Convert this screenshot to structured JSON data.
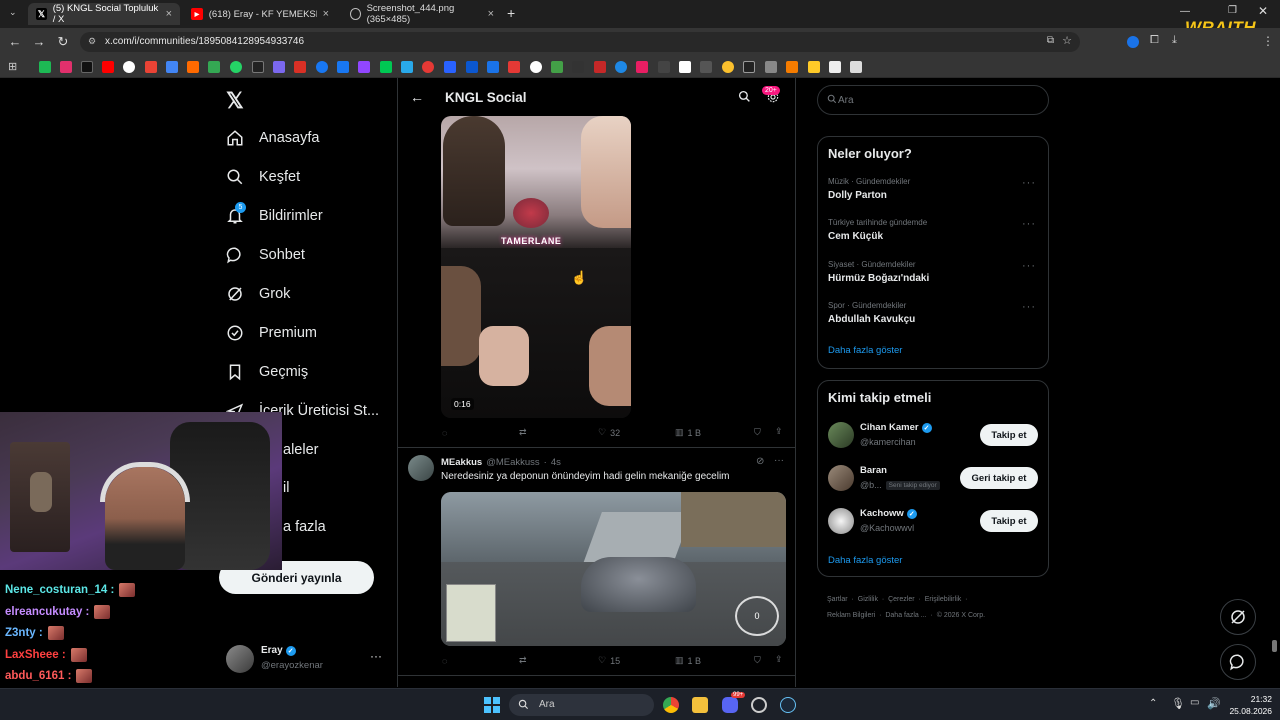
{
  "browser": {
    "tabs": [
      {
        "label": "(5) KNGL Social Topluluk / X",
        "active": true
      },
      {
        "label": "(618) Eray - KF YEMEKSEPETINI",
        "active": false
      },
      {
        "label": "Screenshot_444.png (365×485)",
        "active": false
      }
    ],
    "url": "x.com/i/communities/1895084128954933746",
    "overlay_logo": "WRAITH"
  },
  "sidebar": {
    "items": [
      {
        "label": "Anasayfa",
        "icon": "home-icon"
      },
      {
        "label": "Keşfet",
        "icon": "search-icon"
      },
      {
        "label": "Bildirimler",
        "icon": "bell-icon",
        "badge": "5"
      },
      {
        "label": "Sohbet",
        "icon": "chat-icon"
      },
      {
        "label": "Grok",
        "icon": "grok-icon"
      },
      {
        "label": "Premium",
        "icon": "premium-icon"
      },
      {
        "label": "Geçmiş",
        "icon": "bookmark-icon"
      },
      {
        "label": "İçerik Üreticisi St...",
        "icon": "creator-icon"
      },
      {
        "label": "Makaleler",
        "icon": "article-icon"
      },
      {
        "label": "Profil",
        "icon": "profile-icon"
      },
      {
        "label": "Daha fazla",
        "icon": "more-icon"
      }
    ],
    "visible_partial": {
      "articles": "aleler",
      "profile": "il",
      "more": "a fazla"
    },
    "post_button": "Gönderi yayınla",
    "account": {
      "name": "Eray",
      "handle": "@erayozkenar"
    }
  },
  "header": {
    "title": "KNGL Social",
    "notif_badge": "20+"
  },
  "posts": [
    {
      "media_text": "TAMERLANE",
      "video_duration": "0:16",
      "likes": "32",
      "views": "1 B"
    },
    {
      "author": "MEakkus",
      "handle": "@MEakkuss",
      "time": "4s",
      "text": "Neredesiniz ya deponun önündeyim hadi gelin mekaniğe gecelim",
      "speed": "0",
      "likes": "15",
      "views": "1 B"
    }
  ],
  "right": {
    "search_placeholder": "Ara",
    "trends_title": "Neler oluyor?",
    "trends": [
      {
        "category": "Müzik · Gündemdekiler",
        "name": "Dolly Parton"
      },
      {
        "category": "Türkiye tarihinde gündemde",
        "name": "Cem Küçük"
      },
      {
        "category": "Siyaset · Gündemdekiler",
        "name": "Hürmüz Boğazı'ndaki"
      },
      {
        "category": "Spor · Gündemdekiler",
        "name": "Abdullah Kavukçu"
      }
    ],
    "show_more": "Daha fazla göster",
    "who_title": "Kimi takip etmeli",
    "who": [
      {
        "name": "Cihan Kamer",
        "handle": "@kamercihan",
        "verified": true,
        "button": "Takip et"
      },
      {
        "name": "Baran",
        "handle": "@b...",
        "verified": false,
        "follows_you": "Seni takip ediyor",
        "button": "Geri takip et"
      },
      {
        "name": "Kachoww",
        "handle": "@Kachowwvl",
        "verified": true,
        "button": "Takip et"
      }
    ],
    "who_more": "Daha fazla göster",
    "footer": [
      "Şartlar",
      "Gizlilik",
      "Çerezler",
      "Erişilebilirlik",
      "Reklam Bilgileri",
      "Daha fazla ...",
      "© 2026 X Corp."
    ]
  },
  "chat": {
    "lines": [
      {
        "user": "Nene_costuran_14 :",
        "color": "#5ce6e6"
      },
      {
        "user": "elreancukutay :",
        "color": "#c58cff"
      },
      {
        "user": "Z3nty :",
        "color": "#6ab7ff"
      },
      {
        "user": "LaxSheee :",
        "color": "#ff4040"
      },
      {
        "user": "abdu_6161 :",
        "color": "#ff5a5a"
      }
    ]
  },
  "taskbar": {
    "search": "Ara",
    "time": "21:32",
    "date": "25.08.2026",
    "discord_badge": "99+"
  }
}
